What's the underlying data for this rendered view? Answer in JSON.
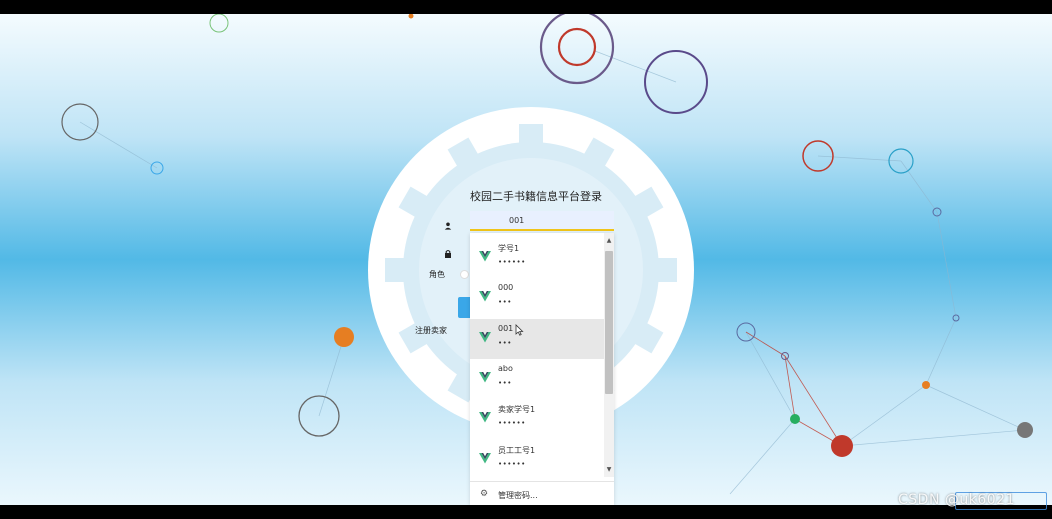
{
  "login": {
    "title": "校园二手书籍信息平台登录",
    "username_value": "001",
    "user_icon": "user-icon",
    "lock_icon": "lock-icon",
    "role_label": "角色",
    "register_label": "注册卖家"
  },
  "autocomplete": {
    "entries": [
      {
        "user": "学号1",
        "password_mask": "••••••"
      },
      {
        "user": "000",
        "password_mask": "•••"
      },
      {
        "user": "001",
        "password_mask": "•••"
      },
      {
        "user": "abo",
        "password_mask": "•••"
      },
      {
        "user": "卖家学号1",
        "password_mask": "••••••"
      },
      {
        "user": "员工工号1",
        "password_mask": "••••••"
      }
    ],
    "highlighted_index": 2,
    "manage_icon": "gear-icon",
    "manage_label": "管理密码..."
  },
  "watermark": {
    "text": "CSDN @uk6021"
  },
  "colors": {
    "accent_blue": "#3aa7e8",
    "focus_underline": "#f0c419",
    "vue_green": "#41b883"
  }
}
